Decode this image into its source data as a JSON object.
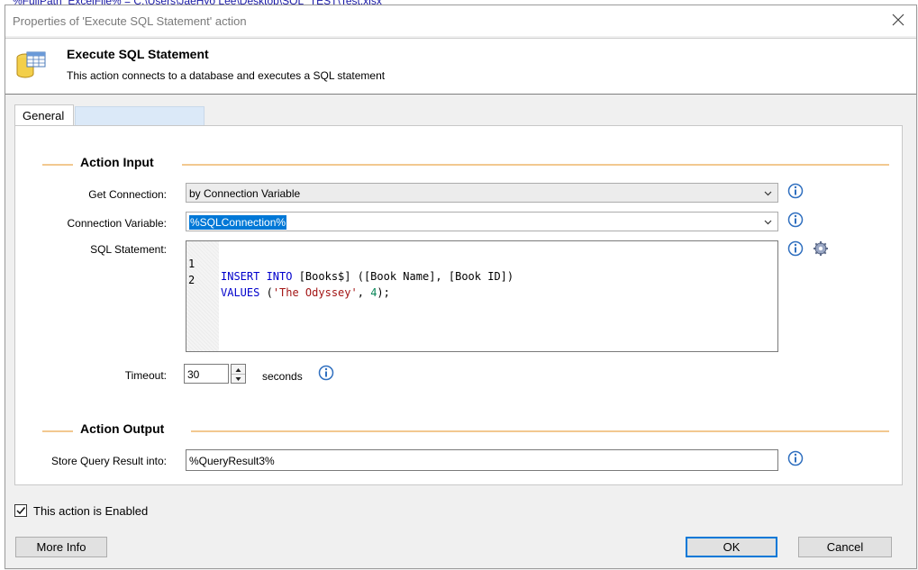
{
  "background_window": {
    "text": "%FullPath_ExcelFile% = C:\\Users\\JaeHyo Lee\\Desktop\\SQL_TEST\\Test.xlsx"
  },
  "dialog": {
    "title": "Properties of 'Execute SQL Statement' action",
    "close_icon": "close-icon"
  },
  "header": {
    "icon": "database-icon",
    "title": "Execute SQL Statement",
    "description": "This action connects to a database and executes a SQL statement"
  },
  "tabs": [
    {
      "label": "General",
      "selected": true
    }
  ],
  "action_input": {
    "title": "Action Input",
    "get_connection": {
      "label": "Get Connection:",
      "value": "by Connection Variable"
    },
    "connection_variable": {
      "label": "Connection Variable:",
      "value": "%SQLConnection%"
    },
    "sql_statement": {
      "label": "SQL Statement:",
      "lines": [
        {
          "number": "1",
          "text": "INSERT INTO [Books$] ([Book Name], [Book ID])"
        },
        {
          "number": "2",
          "text": "VALUES ('The Odyssey', 4);"
        }
      ]
    },
    "timeout": {
      "label": "Timeout:",
      "value": "30",
      "unit": "seconds"
    }
  },
  "action_output": {
    "title": "Action Output",
    "store_result": {
      "label": "Store Query Result into:",
      "value": "%QueryResult3%"
    }
  },
  "footer": {
    "enabled_label": "This action is Enabled",
    "enabled_checked": true,
    "more_info_label": "More Info",
    "ok_label": "OK",
    "cancel_label": "Cancel"
  },
  "colors": {
    "section_rule": "#f2c890",
    "keyword": "#0000cc",
    "string": "#a31515",
    "number": "#098658",
    "selection": "#0078d7"
  }
}
